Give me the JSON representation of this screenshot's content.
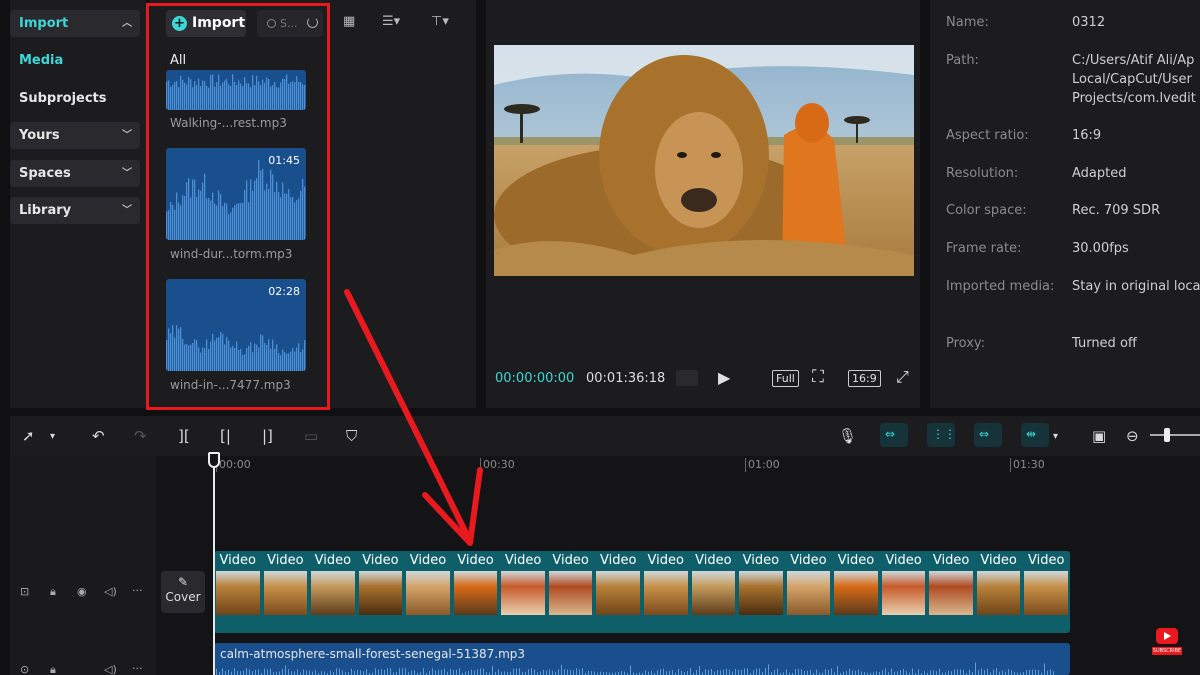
{
  "nav": {
    "import": "Import",
    "media": "Media",
    "subprojects": "Subprojects",
    "yours": "Yours",
    "spaces": "Spaces",
    "library": "Library"
  },
  "media_panel": {
    "import_button": "Import",
    "search_placeholder": "S...",
    "filter_all": "All",
    "items": [
      {
        "name": "Walking-...rest.mp3",
        "duration": ""
      },
      {
        "name": "wind-dur...torm.mp3",
        "duration": "01:45"
      },
      {
        "name": "wind-in-...7477.mp3",
        "duration": "02:28"
      }
    ]
  },
  "player": {
    "current_time": "00:00:00:00",
    "total_time": "00:01:36:18",
    "full_label": "Full",
    "ratio_label": "16:9"
  },
  "details": {
    "rows": [
      {
        "label": "Name:",
        "value": "0312"
      },
      {
        "label": "Path:",
        "value": "C:/Users/Atif Ali/Ap\nLocal/CapCut/User\nProjects/com.lvedit"
      },
      {
        "label": "Aspect ratio:",
        "value": "16:9"
      },
      {
        "label": "Resolution:",
        "value": "Adapted"
      },
      {
        "label": "Color space:",
        "value": "Rec. 709 SDR"
      },
      {
        "label": "Frame rate:",
        "value": "30.00fps"
      },
      {
        "label": "Imported media:",
        "value": "Stay in original loca"
      },
      {
        "label": "Proxy:",
        "value": "Turned off"
      }
    ]
  },
  "timeline": {
    "ruler": [
      "00:00",
      "00:30",
      "01:00",
      "01:30"
    ],
    "clip_label": "Video",
    "clip_count": 18,
    "cover_label": "Cover",
    "audio_clip": "calm-atmosphere-small-forest-senegal-51387.mp3"
  },
  "watermark": {
    "subscribe": "SUBSCRIBE"
  },
  "colors": {
    "accent": "#3ed7d7",
    "highlight": "#e8191f",
    "audio": "#1a4f8d",
    "video_track": "#0f5f6b"
  }
}
